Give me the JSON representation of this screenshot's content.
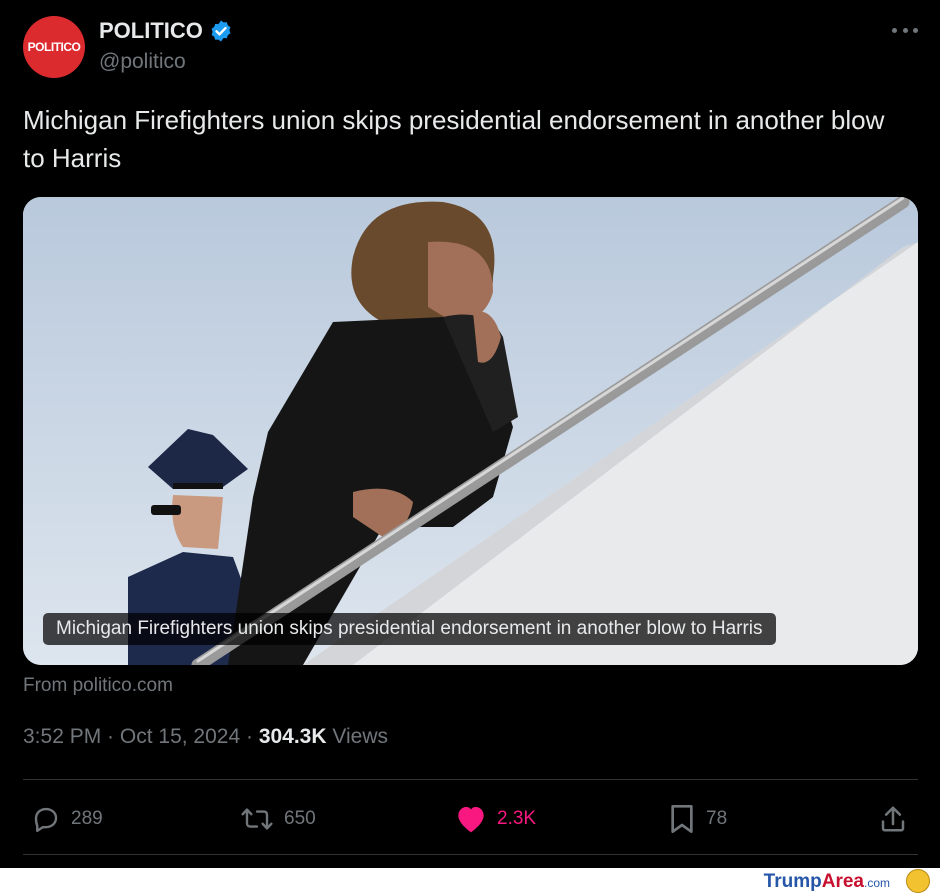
{
  "account": {
    "avatar_text": "POLITICO",
    "display_name": "POLITICO",
    "handle": "@politico",
    "verified_color": "#1d9bf0",
    "avatar_color": "#dc2b2f"
  },
  "tweet": {
    "text": "Michigan Firefighters union skips presidential endorsement in another blow to Harris"
  },
  "card": {
    "caption": "Michigan Firefighters union skips presidential endorsement in another blow to Harris",
    "source": "From politico.com"
  },
  "meta": {
    "time": "3:52 PM",
    "separator1": " · ",
    "date": "Oct 15, 2024",
    "separator2": " · ",
    "views_count": "304.3K",
    "views_label": " Views"
  },
  "actions": {
    "replies": "289",
    "reposts": "650",
    "likes": "2.3K",
    "bookmarks": "78",
    "like_color": "#f91880"
  },
  "watermark": {
    "trump": "Trump",
    "area": "Area",
    "com": ".com"
  }
}
